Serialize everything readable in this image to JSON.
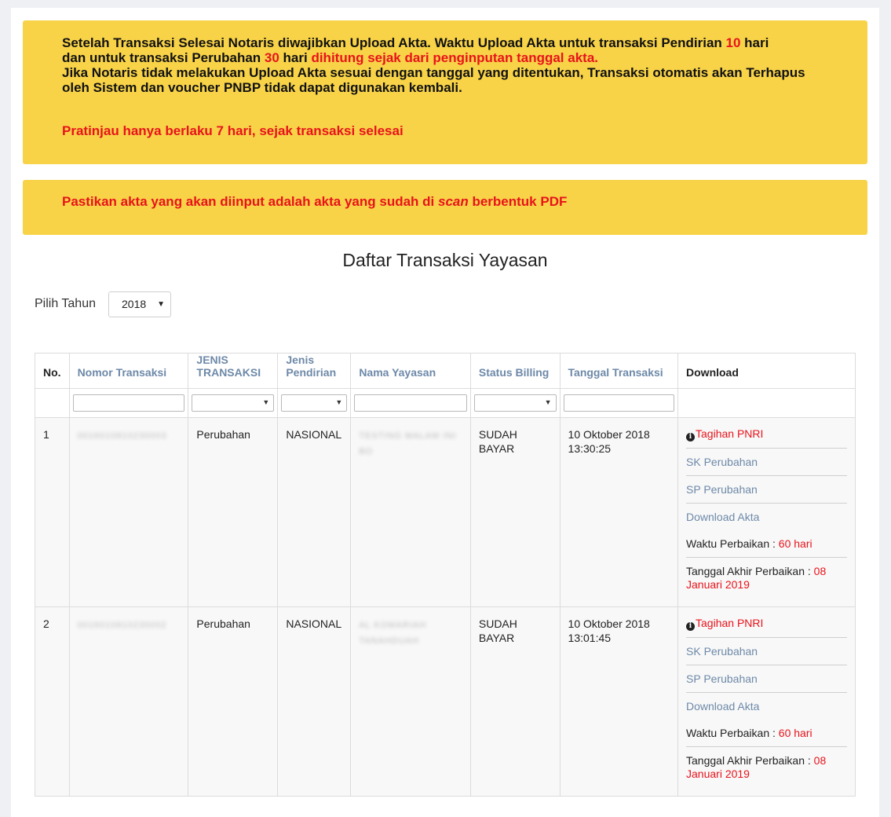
{
  "alert1": {
    "line1_a": "Setelah Transaksi Selesai Notaris diwajibkan Upload Akta. Waktu Upload Akta untuk transaksi Pendirian ",
    "line1_num": "10",
    "line1_b": " hari",
    "line2_a": "dan untuk transaksi Perubahan ",
    "line2_num": "30",
    "line2_b": " hari ",
    "line2_red": "dihitung sejak dari penginputan tanggal akta.",
    "line3": "Jika Notaris tidak melakukan Upload Akta sesuai dengan tanggal yang ditentukan, Transaksi otomatis akan Terhapus oleh Sistem dan voucher PNBP tidak dapat digunakan kembali.",
    "note": "Pratinjau hanya berlaku 7 hari, sejak transaksi selesai"
  },
  "alert2": {
    "text_a": "Pastikan akta yang akan diinput adalah akta yang sudah di ",
    "text_italic": "scan",
    "text_b": " berbentuk PDF"
  },
  "page_title": "Daftar Transaksi Yayasan",
  "year_filter": {
    "label": "Pilih Tahun",
    "selected": "2018"
  },
  "table": {
    "headers": {
      "no": "No.",
      "nomor": "Nomor Transaksi",
      "jenis_transaksi_1": "JENIS",
      "jenis_transaksi_2": "TRANSAKSI",
      "jenis_pendirian_1": "Jenis",
      "jenis_pendirian_2": "Pendirian",
      "nama": "Nama Yayasan",
      "status": "Status Billing",
      "tanggal": "Tanggal Transaksi",
      "download": "Download"
    },
    "rows": [
      {
        "no": "1",
        "nomor": "0016010810230003",
        "jenis": "Perubahan",
        "pendirian": "NASIONAL",
        "nama_1": "TESTING MALAM INI",
        "nama_2": "BO",
        "status": "SUDAH BAYAR",
        "tanggal_1": "10 Oktober 2018",
        "tanggal_2": "13:30:25",
        "tagihan": "Tagihan PNRI",
        "sk": "SK Perubahan",
        "sp": "SP Perubahan",
        "download_akta": "Download Akta",
        "waktu_label": "Waktu Perbaikan : ",
        "waktu_value": "60 hari",
        "akhir_label": "Tanggal Akhir Perbaikan : ",
        "akhir_value_1": "08",
        "akhir_value_2": "Januari 2019"
      },
      {
        "no": "2",
        "nomor": "0016010810230002",
        "jenis": "Perubahan",
        "pendirian": "NASIONAL",
        "nama_1": "AL KOMARIAH",
        "nama_2": "TANAHDUAH",
        "status": "SUDAH BAYAR",
        "tanggal_1": "10 Oktober 2018",
        "tanggal_2": "13:01:45",
        "tagihan": "Tagihan PNRI",
        "sk": "SK Perubahan",
        "sp": "SP Perubahan",
        "download_akta": "Download Akta",
        "waktu_label": "Waktu Perbaikan : ",
        "waktu_value": "60 hari",
        "akhir_label": "Tanggal Akhir Perbaikan : ",
        "akhir_value_1": "08",
        "akhir_value_2": "Januari 2019"
      }
    ]
  }
}
